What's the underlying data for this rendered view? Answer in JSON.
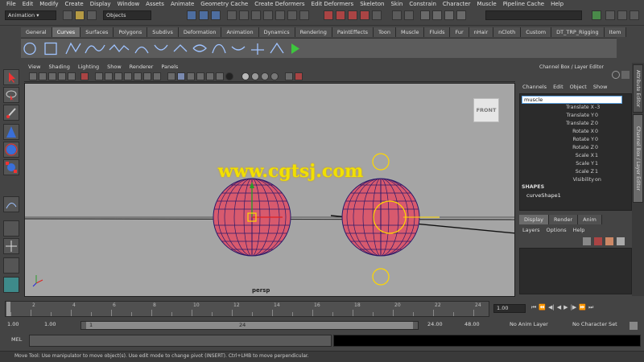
{
  "menubar": [
    "File",
    "Edit",
    "Modify",
    "Create",
    "Display",
    "Window",
    "Assets",
    "Animate",
    "Geometry Cache",
    "Create Deformers",
    "Edit Deformers",
    "Skeleton",
    "Skin",
    "Constrain",
    "Character",
    "Muscle",
    "Pipeline Cache",
    "Help"
  ],
  "statusline": {
    "mode": "Animation",
    "selection_mode": "Objects"
  },
  "shelf_tabs": [
    "General",
    "Curves",
    "Surfaces",
    "Polygons",
    "Subdivs",
    "Deformation",
    "Animation",
    "Dynamics",
    "Rendering",
    "PaintEffects",
    "Toon",
    "Muscle",
    "Fluids",
    "Fur",
    "nHair",
    "nCloth",
    "Custom",
    "DT_TRP_Rigging",
    "Item"
  ],
  "shelf_active": "Curves",
  "panel_menu": [
    "View",
    "Shading",
    "Lighting",
    "Show",
    "Renderer",
    "Panels"
  ],
  "viewport": {
    "camera_label": "persp",
    "viewcube_label": "FRONT",
    "watermark": "www.cgtsj.com"
  },
  "channel_box": {
    "title": "Channel Box / Layer Editor",
    "menu": [
      "Channels",
      "Edit",
      "Object",
      "Show"
    ],
    "object_name": "muscle",
    "attributes": [
      {
        "name": "Translate X",
        "value": "-3"
      },
      {
        "name": "Translate Y",
        "value": "0"
      },
      {
        "name": "Translate Z",
        "value": "0"
      },
      {
        "name": "Rotate X",
        "value": "0"
      },
      {
        "name": "Rotate Y",
        "value": "0"
      },
      {
        "name": "Rotate Z",
        "value": "0"
      },
      {
        "name": "Scale X",
        "value": "1"
      },
      {
        "name": "Scale Y",
        "value": "1"
      },
      {
        "name": "Scale Z",
        "value": "1"
      },
      {
        "name": "Visibility",
        "value": "on"
      }
    ],
    "shapes_header": "SHAPES",
    "shape_name": "curveShape1"
  },
  "side_tabs": [
    "Attribute Editor",
    "Channel Box / Layer Editor"
  ],
  "layer_editor": {
    "tabs": [
      "Display",
      "Render",
      "Anim"
    ],
    "menu": [
      "Layers",
      "Options",
      "Help"
    ]
  },
  "timeline": {
    "ticks": [
      "2",
      "4",
      "6",
      "8",
      "10",
      "12",
      "14",
      "16",
      "18",
      "20",
      "22",
      "24"
    ],
    "current_frame": "1.00"
  },
  "range": {
    "start": "1.00",
    "playback_start": "1.00",
    "slider_start": "1",
    "slider_end": "24",
    "playback_end": "24.00",
    "end": "48.00",
    "anim_layer": "No Anim Layer",
    "character_set": "No Character Set"
  },
  "command_line": {
    "label": "MEL"
  },
  "help_line": "Move Tool: Use manipulator to move object(s). Use edit mode to change pivot (INSERT). Ctrl+LMB to move perpendicular.",
  "colors": {
    "viewport_bg": "#a5a5a5",
    "sphere_fill": "#d85a6e",
    "wire": "#2a1a6a",
    "highlight": "#ffd700"
  }
}
